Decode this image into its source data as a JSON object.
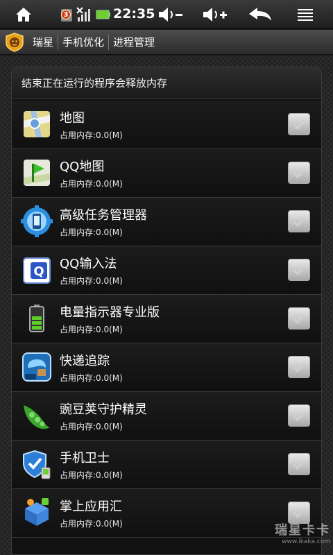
{
  "status_bar": {
    "time": "22:35",
    "notification_count": "3",
    "icons": [
      "home-icon",
      "notification-icon",
      "signal-icon",
      "battery-icon",
      "volume-down-icon",
      "volume-up-icon",
      "back-icon",
      "menu-icon"
    ]
  },
  "title_bar": {
    "crumbs": [
      "瑞星",
      "手机优化",
      "进程管理"
    ]
  },
  "panel": {
    "header": "结束正在运行的程序会释放内存"
  },
  "apps": [
    {
      "name": "地图",
      "memory": "占用内存:0.0(M)",
      "icon": "maps-icon",
      "checked": true
    },
    {
      "name": "QQ地图",
      "memory": "占用内存:0.0(M)",
      "icon": "qq-map-icon",
      "checked": true
    },
    {
      "name": "高级任务管理器",
      "memory": "占用内存:0.0(M)",
      "icon": "task-manager-icon",
      "checked": true
    },
    {
      "name": "QQ输入法",
      "memory": "占用内存:0.0(M)",
      "icon": "qq-input-icon",
      "checked": true
    },
    {
      "name": "电量指示器专业版",
      "memory": "占用内存:0.0(M)",
      "icon": "battery-indicator-icon",
      "checked": true
    },
    {
      "name": "快递追踪",
      "memory": "占用内存:0.0(M)",
      "icon": "express-tracking-icon",
      "checked": true
    },
    {
      "name": "豌豆荚守护精灵",
      "memory": "占用内存:0.0(M)",
      "icon": "wandoujia-icon",
      "checked": true
    },
    {
      "name": "手机卫士",
      "memory": "占用内存:0.0(M)",
      "icon": "phone-guard-icon",
      "checked": true
    },
    {
      "name": "掌上应用汇",
      "memory": "占用内存:0.0(M)",
      "icon": "app-store-icon",
      "checked": true
    }
  ],
  "watermark": {
    "line1": "瑞星卡卡",
    "line2": "www.ikaka.com"
  }
}
